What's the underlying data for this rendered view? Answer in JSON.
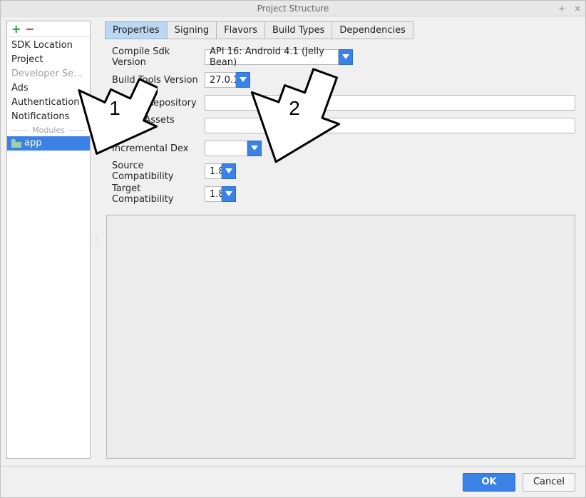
{
  "window": {
    "title": "Project Structure",
    "minimize_glyph": "+",
    "close_glyph": "×"
  },
  "sidebar": {
    "add_glyph": "+",
    "remove_glyph": "−",
    "items": [
      {
        "label": "SDK Location",
        "kind": "item"
      },
      {
        "label": "Project",
        "kind": "item"
      },
      {
        "label": "Developer Servic...",
        "kind": "disabled"
      },
      {
        "label": "Ads",
        "kind": "item"
      },
      {
        "label": "Authentication",
        "kind": "item"
      },
      {
        "label": "Notifications",
        "kind": "item"
      }
    ],
    "modules_header": "Modules",
    "selected_module": "app"
  },
  "tabs": [
    {
      "label": "Properties",
      "active": true
    },
    {
      "label": "Signing",
      "active": false
    },
    {
      "label": "Flavors",
      "active": false
    },
    {
      "label": "Build Types",
      "active": false
    },
    {
      "label": "Dependencies",
      "active": false
    }
  ],
  "form": {
    "compile_sdk": {
      "label": "Compile Sdk Version",
      "value": "API 16: Android 4.1 (Jelly Bean)"
    },
    "build_tools": {
      "label": "Build Tools Version",
      "value": "27.0.1"
    },
    "library_repo": {
      "label": "Library Repository",
      "value": ""
    },
    "ignore_assets": {
      "label": "Ignore Assets Pattern",
      "value": ""
    },
    "incremental_dex": {
      "label": "Incremental Dex",
      "value": ""
    },
    "source_compat": {
      "label": "Source Compatibility",
      "value": "1.8"
    },
    "target_compat": {
      "label": "Target Compatibility",
      "value": "1.8"
    }
  },
  "footer": {
    "ok": "OK",
    "cancel": "Cancel"
  },
  "annotations": {
    "arrow1": "1",
    "arrow2": "2"
  }
}
